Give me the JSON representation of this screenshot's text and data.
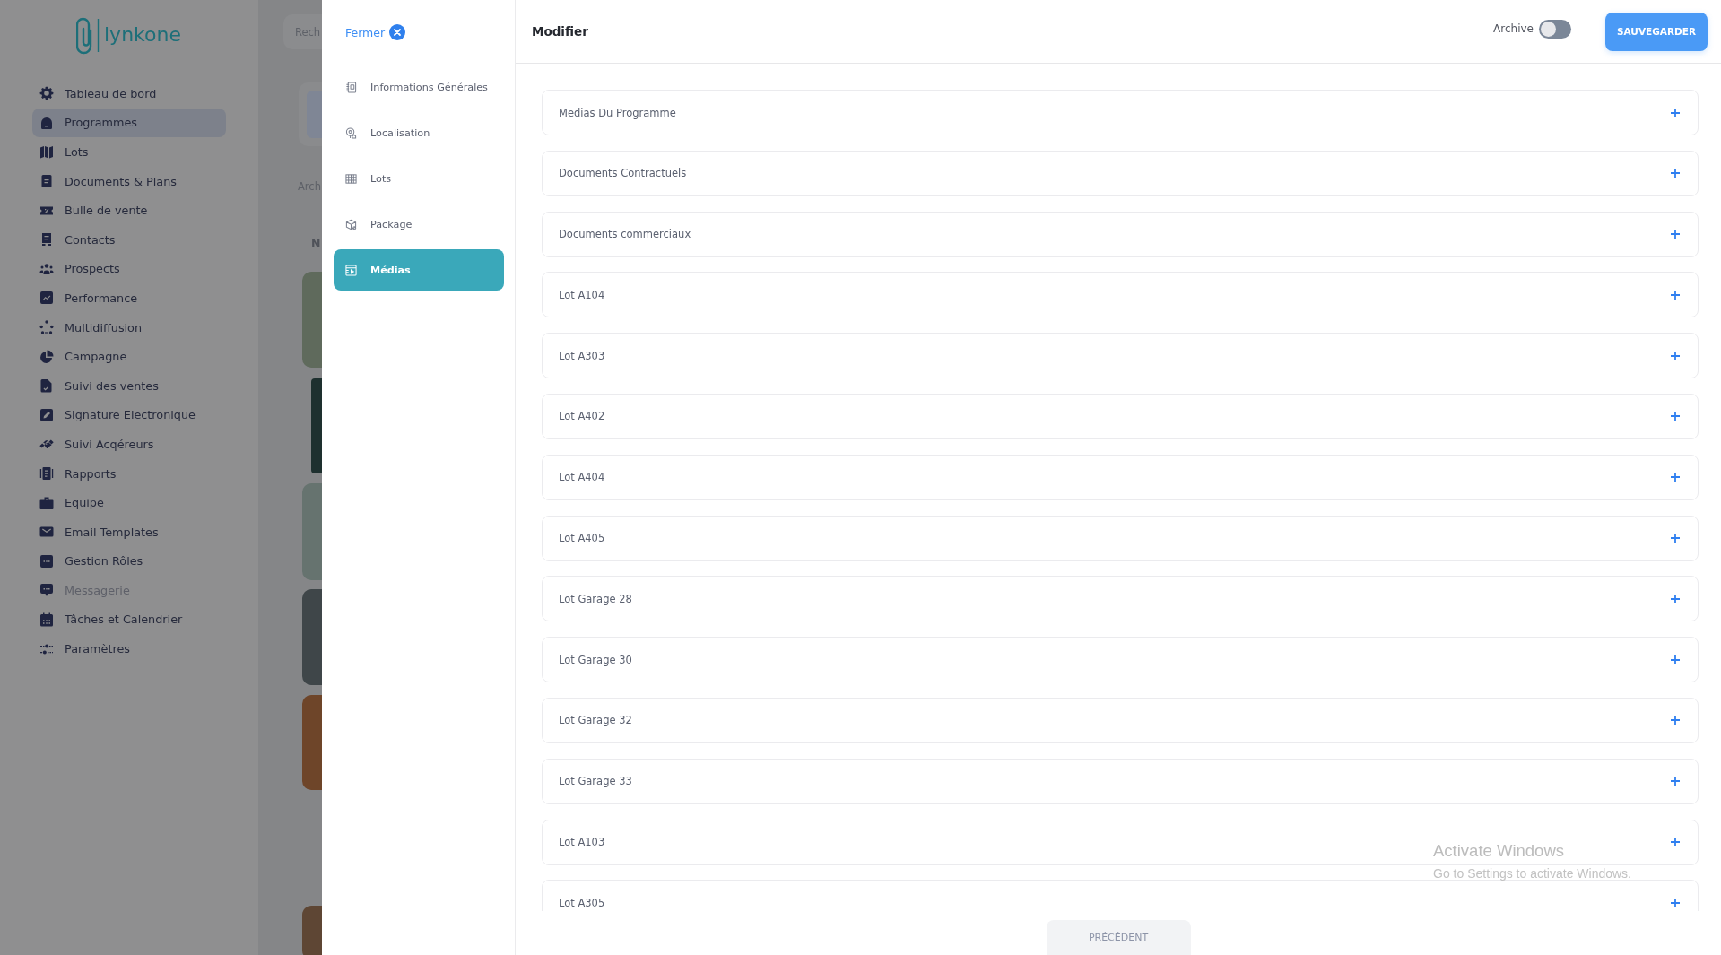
{
  "app_sidebar": {
    "logo": "lynkone",
    "items": [
      {
        "label": "Tableau de bord",
        "selected": false,
        "disabled": false
      },
      {
        "label": "Programmes",
        "selected": true,
        "disabled": false
      },
      {
        "label": "Lots",
        "selected": false,
        "disabled": false
      },
      {
        "label": "Documents & Plans",
        "selected": false,
        "disabled": false
      },
      {
        "label": "Bulle de vente",
        "selected": false,
        "disabled": false
      },
      {
        "label": "Contacts",
        "selected": false,
        "disabled": false
      },
      {
        "label": "Prospects",
        "selected": false,
        "disabled": false
      },
      {
        "label": "Performance",
        "selected": false,
        "disabled": false
      },
      {
        "label": "Multidiffusion",
        "selected": false,
        "disabled": false
      },
      {
        "label": "Campagne",
        "selected": false,
        "disabled": false
      },
      {
        "label": "Suivi des ventes",
        "selected": false,
        "disabled": false
      },
      {
        "label": "Signature Electronique",
        "selected": false,
        "disabled": false
      },
      {
        "label": "Suivi Acqéreurs",
        "selected": false,
        "disabled": false
      },
      {
        "label": "Rapports",
        "selected": false,
        "disabled": false
      },
      {
        "label": "Equipe",
        "selected": false,
        "disabled": false
      },
      {
        "label": "Email Templates",
        "selected": false,
        "disabled": false
      },
      {
        "label": "Gestion Rôles",
        "selected": false,
        "disabled": false
      },
      {
        "label": "Messagerie",
        "selected": false,
        "disabled": true
      },
      {
        "label": "Tâches et Calendrier",
        "selected": false,
        "disabled": false
      },
      {
        "label": "Paramètres",
        "selected": false,
        "disabled": false
      }
    ]
  },
  "background_page": {
    "search": {
      "placeholder": "Rech"
    },
    "label": "Arch",
    "column_heading": "N"
  },
  "drawer": {
    "close_label": "Fermer",
    "nav": [
      {
        "label": "Informations Générales",
        "selected": false
      },
      {
        "label": "Localisation",
        "selected": false
      },
      {
        "label": "Lots",
        "selected": false
      },
      {
        "label": "Package",
        "selected": false
      },
      {
        "label": "Médias",
        "selected": true
      }
    ],
    "title": "Modifier",
    "archive": {
      "label": "Archive",
      "on": false
    },
    "save_button": "SAUVEGARDER",
    "sections": [
      {
        "title": "Medias Du Programme",
        "expanded": false
      },
      {
        "title": "Documents Contractuels",
        "expanded": false
      },
      {
        "title": "Documents commerciaux",
        "expanded": false
      },
      {
        "title": "Lot A104",
        "expanded": false
      },
      {
        "title": "Lot A303",
        "expanded": false
      },
      {
        "title": "Lot A402",
        "expanded": false
      },
      {
        "title": "Lot A404",
        "expanded": false
      },
      {
        "title": "Lot A405",
        "expanded": false
      },
      {
        "title": "Lot Garage 28",
        "expanded": false
      },
      {
        "title": "Lot Garage 30",
        "expanded": false
      },
      {
        "title": "Lot Garage 32",
        "expanded": false
      },
      {
        "title": "Lot Garage 33",
        "expanded": false
      },
      {
        "title": "Lot A103",
        "expanded": false
      },
      {
        "title": "Lot A305",
        "expanded": false
      }
    ],
    "previous_button": "PRÉCÉDENT"
  },
  "os_watermark": {
    "title": "Activate Windows",
    "subtitle": "Go to Settings to activate Windows."
  }
}
